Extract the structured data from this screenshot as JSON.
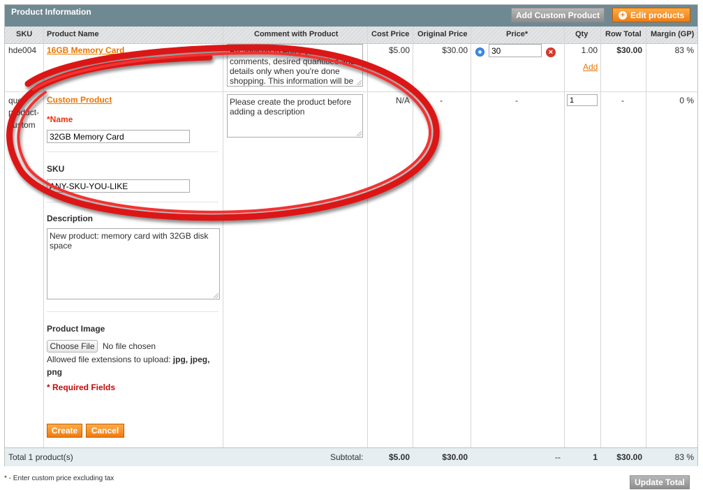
{
  "header": {
    "title": "Product Information",
    "add_custom_label": "Add Custom Product",
    "edit_products_label": "Edit products",
    "edit_icon": "plus-circle-icon"
  },
  "columns": [
    "SKU",
    "Product Name",
    "Comment with Product",
    "Cost Price",
    "Original Price",
    "Price*",
    "Qty",
    "Row Total",
    "Margin (GP)"
  ],
  "row1": {
    "sku": "hde004",
    "name": "16GB Memory Card",
    "comment": "Be advised to enter your comments, desired quantities and details only when you're done shopping. This information will be",
    "cost": "$5.00",
    "original": "$30.00",
    "price_value": "30",
    "qty": "1.00",
    "add_label": "Add",
    "row_total": "$30.00",
    "margin": "83 %"
  },
  "row2": {
    "sku_line1": "quo",
    "sku_line2": "product-",
    "sku_line3": "custom",
    "name": "Custom Product",
    "name_label": "Name",
    "name_required_mark": "*",
    "name_value": "32GB Memory Card",
    "sku_label": "SKU",
    "sku_value": "ANY-SKU-YOU-LIKE",
    "description_label": "Description",
    "description_value": "New product: memory card with 32GB disk space",
    "image_label": "Product Image",
    "choose_file": "Choose File",
    "no_file": "No file chosen",
    "ext_prefix": "Allowed file extensions to upload: ",
    "ext_bold1": "jpg, jpeg,",
    "ext_bold2": "png",
    "required_fields": "* Required Fields",
    "create_label": "Create",
    "cancel_label": "Cancel",
    "comment": "Please create the product before adding a description",
    "cost": "N/A",
    "original": "-",
    "price": "-",
    "qty_value": "1",
    "row_total": "-",
    "margin": "0 %"
  },
  "footer": {
    "total_products": "Total 1 product(s)",
    "subtotal_label": "Subtotal:",
    "cost": "$5.00",
    "original": "$30.00",
    "price": "--",
    "qty": "1",
    "row_total": "$30.00",
    "margin": "83 %"
  },
  "note": "* - Enter custom price excluding tax",
  "update_total_label": "Update Total",
  "colors": {
    "header_bg": "#6f8992",
    "accent_orange": "#f17b0f",
    "link_orange": "#ea7601",
    "annotation_red": "#e01717"
  }
}
